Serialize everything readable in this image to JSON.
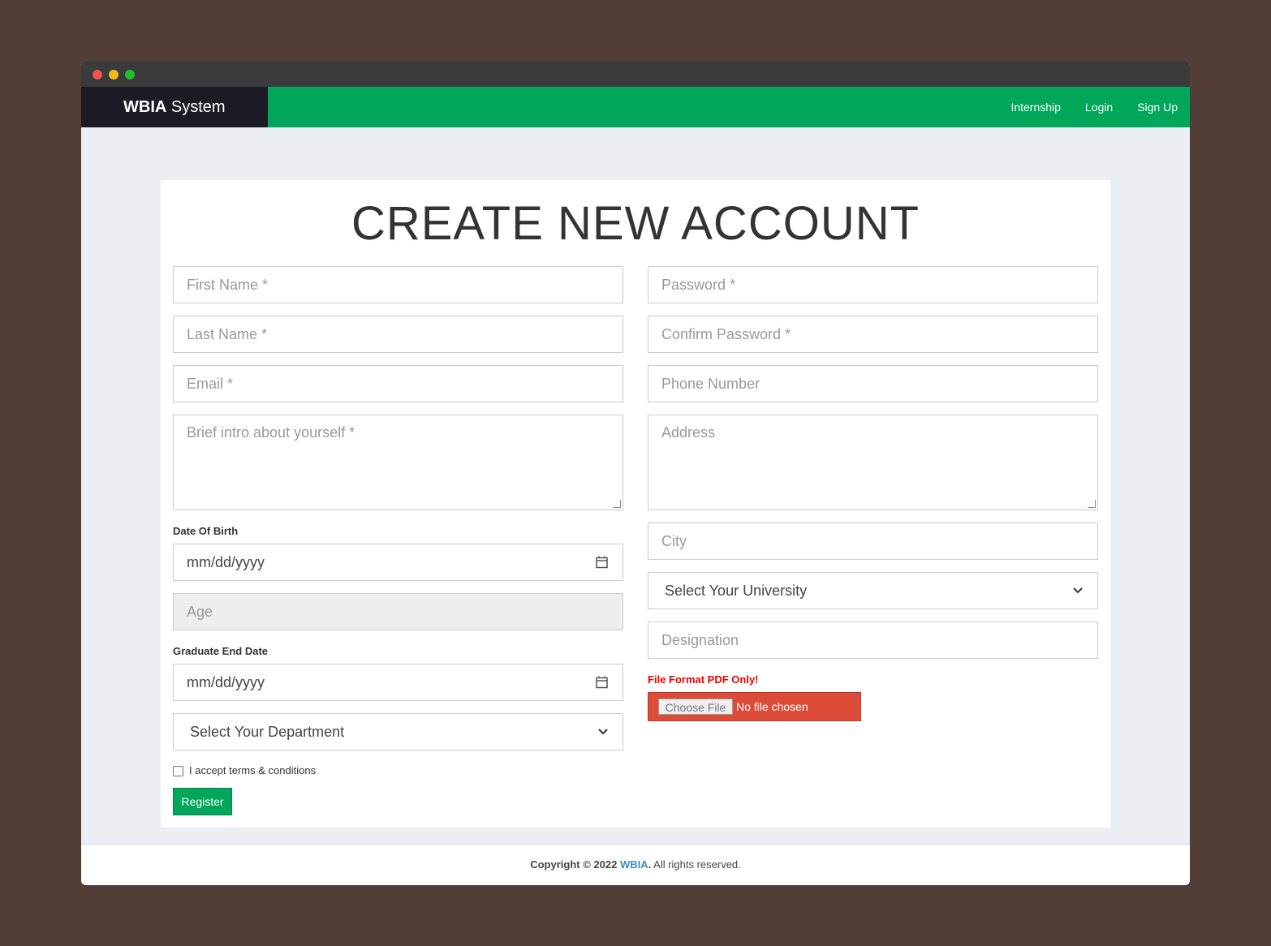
{
  "nav": {
    "brand_bold": "WBIA",
    "brand_rest": " System",
    "links": [
      "Internship",
      "Login",
      "Sign Up"
    ]
  },
  "form": {
    "title": "CREATE NEW ACCOUNT",
    "first_name": "First Name *",
    "last_name": "Last Name *",
    "email": "Email *",
    "intro": "Brief intro about yourself *",
    "dob_label": "Date Of Birth",
    "dob_value": "mm/dd/yyyy",
    "age": "Age",
    "grad_label": "Graduate End Date",
    "grad_value": "mm/dd/yyyy",
    "department": "Select Your Department",
    "password": "Password *",
    "confirm_password": "Confirm Password *",
    "phone": "Phone Number",
    "address": "Address",
    "city": "City",
    "university": "Select Your University",
    "designation": "Designation",
    "file_note": "File Format PDF Only!",
    "file_button": "Choose File",
    "file_status": "No file chosen",
    "terms": "I accept terms & conditions",
    "register": "Register"
  },
  "footer": {
    "prefix": "Copyright © 2022 ",
    "brand": "WBIA",
    "dot": ".",
    "suffix": " All rights reserved."
  }
}
